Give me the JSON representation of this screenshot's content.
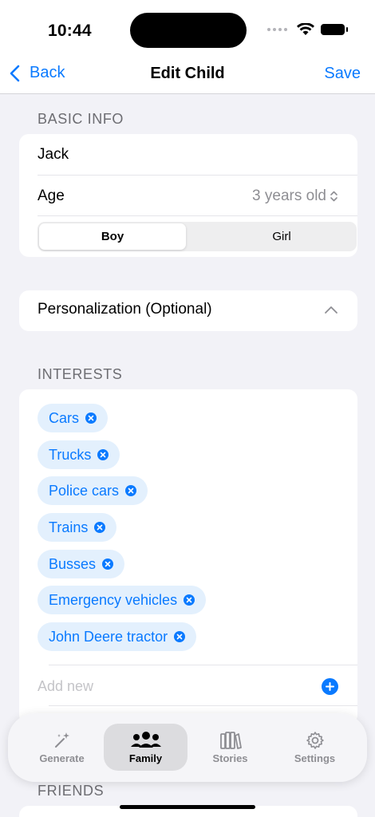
{
  "status_bar": {
    "time": "10:44"
  },
  "nav": {
    "back_label": "Back",
    "title": "Edit Child",
    "save_label": "Save"
  },
  "basic_info": {
    "header": "BASIC INFO",
    "name": "Jack",
    "age_label": "Age",
    "age_value": "3 years old",
    "gender_options": [
      "Boy",
      "Girl"
    ],
    "gender_selected": "Boy"
  },
  "personalization": {
    "label": "Personalization (Optional)"
  },
  "interests": {
    "header": "INTERESTS",
    "items": [
      "Cars",
      "Trucks",
      "Police cars",
      "Trains",
      "Busses",
      "Emergency vehicles",
      "John Deere tractor"
    ],
    "add_placeholder": "Add new"
  },
  "friends": {
    "header": "FRIENDS"
  },
  "tabs": [
    {
      "label": "Generate",
      "icon": "sparkles-wand-icon"
    },
    {
      "label": "Family",
      "icon": "people-icon",
      "active": true
    },
    {
      "label": "Stories",
      "icon": "books-icon"
    },
    {
      "label": "Settings",
      "icon": "gear-icon"
    }
  ],
  "colors": {
    "accent": "#0a7aff",
    "chip_bg": "#e3f0fd",
    "background": "#f2f2f7"
  }
}
